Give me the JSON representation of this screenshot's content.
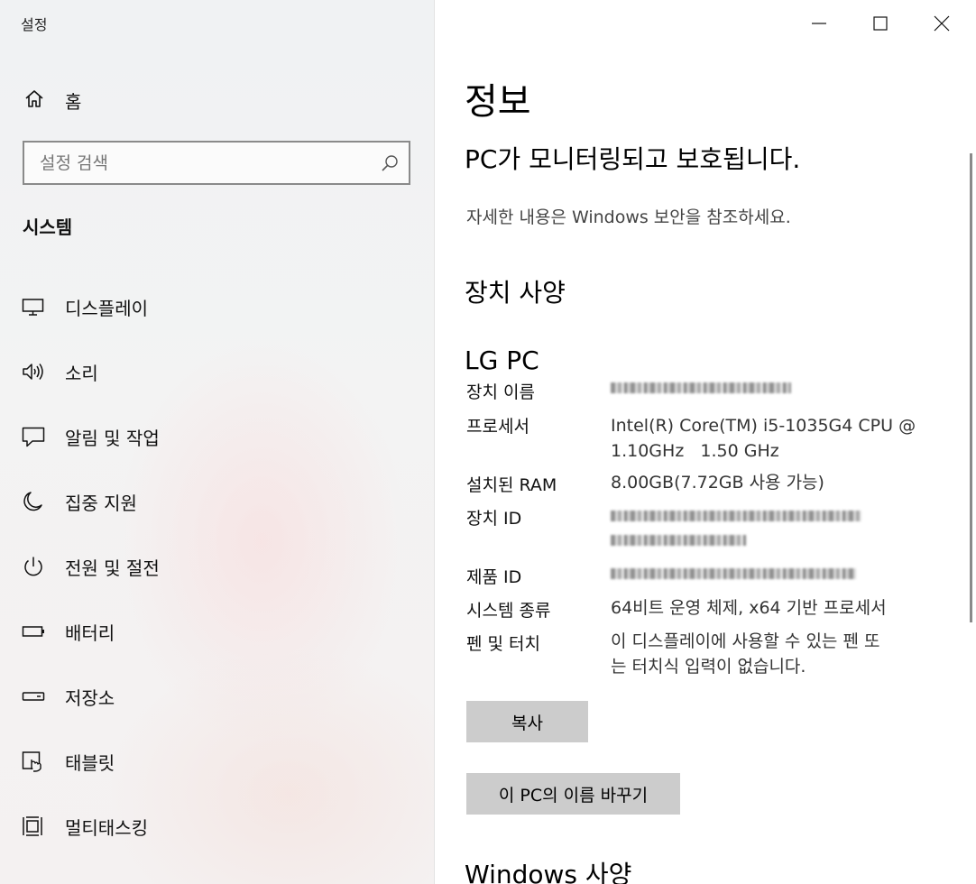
{
  "window": {
    "app_title": "설정"
  },
  "sidebar": {
    "home_label": "홈",
    "search_placeholder": "설정 검색",
    "section_title": "시스템",
    "items": [
      {
        "label": "디스플레이",
        "icon": "monitor-icon"
      },
      {
        "label": "소리",
        "icon": "speaker-icon"
      },
      {
        "label": "알림 및 작업",
        "icon": "notification-icon"
      },
      {
        "label": "집중 지원",
        "icon": "moon-icon"
      },
      {
        "label": "전원 및 절전",
        "icon": "power-icon"
      },
      {
        "label": "배터리",
        "icon": "battery-icon"
      },
      {
        "label": "저장소",
        "icon": "storage-icon"
      },
      {
        "label": "태블릿",
        "icon": "tablet-icon"
      },
      {
        "label": "멀티태스킹",
        "icon": "multitasking-icon"
      }
    ]
  },
  "main": {
    "page_title": "정보",
    "protection_heading": "PC가 모니터링되고 보호됩니다.",
    "protection_link": "자세한 내용은 Windows 보안을 참조하세요.",
    "device_spec_heading": "장치 사양",
    "device_model": "LG PC",
    "specs": {
      "device_name_label": "장치 이름",
      "processor_label": "프로세서",
      "processor_value_line1": "Intel(R) Core(TM) i5-1035G4 CPU @",
      "processor_value_line2": "1.10GHz   1.50 GHz",
      "ram_label": "설치된 RAM",
      "ram_value": "8.00GB(7.72GB 사용 가능)",
      "device_id_label": "장치 ID",
      "product_id_label": "제품 ID",
      "system_type_label": "시스템 종류",
      "system_type_value": "64비트 운영 체제, x64 기반 프로세서",
      "pen_touch_label": "펜 및 터치",
      "pen_touch_value_line1": "이 디스플레이에 사용할 수 있는 펜 또",
      "pen_touch_value_line2": "는 터치식 입력이 없습니다."
    },
    "copy_button": "복사",
    "rename_button": "이 PC의 이름 바꾸기",
    "windows_spec_heading": "Windows 사양"
  }
}
